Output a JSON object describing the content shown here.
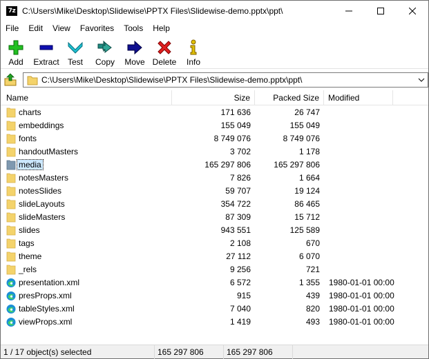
{
  "window": {
    "app_icon_text": "7z",
    "title": "C:\\Users\\Mike\\Desktop\\Slidewise\\PPTX Files\\Slidewise-demo.pptx\\ppt\\"
  },
  "menu": [
    "File",
    "Edit",
    "View",
    "Favorites",
    "Tools",
    "Help"
  ],
  "toolbar": [
    {
      "label": "Add",
      "icon": "plus-icon",
      "color": "#22c022"
    },
    {
      "label": "Extract",
      "icon": "minus-icon",
      "color": "#1010b0"
    },
    {
      "label": "Test",
      "icon": "check-chevron-icon",
      "color": "#20c0d0"
    },
    {
      "label": "Copy",
      "icon": "double-arrow-icon",
      "color": "#1e8a80"
    },
    {
      "label": "Move",
      "icon": "right-arrow-icon",
      "color": "#101090"
    },
    {
      "label": "Delete",
      "icon": "x-icon",
      "color": "#e02020"
    },
    {
      "label": "Info",
      "icon": "info-icon",
      "color": "#e0c000"
    }
  ],
  "address": {
    "path": "C:\\Users\\Mike\\Desktop\\Slidewise\\PPTX Files\\Slidewise-demo.pptx\\ppt\\"
  },
  "columns": {
    "name": "Name",
    "size": "Size",
    "packed": "Packed Size",
    "modified": "Modified"
  },
  "rows": [
    {
      "name": "charts",
      "type": "folder",
      "size": "171 636",
      "packed": "26 747",
      "modified": ""
    },
    {
      "name": "embeddings",
      "type": "folder",
      "size": "155 049",
      "packed": "155 049",
      "modified": ""
    },
    {
      "name": "fonts",
      "type": "folder",
      "size": "8 749 076",
      "packed": "8 749 076",
      "modified": ""
    },
    {
      "name": "handoutMasters",
      "type": "folder",
      "size": "3 702",
      "packed": "1 178",
      "modified": ""
    },
    {
      "name": "media",
      "type": "folder",
      "size": "165 297 806",
      "packed": "165 297 806",
      "modified": "",
      "selected": true
    },
    {
      "name": "notesMasters",
      "type": "folder",
      "size": "7 826",
      "packed": "1 664",
      "modified": ""
    },
    {
      "name": "notesSlides",
      "type": "folder",
      "size": "59 707",
      "packed": "19 124",
      "modified": ""
    },
    {
      "name": "slideLayouts",
      "type": "folder",
      "size": "354 722",
      "packed": "86 465",
      "modified": ""
    },
    {
      "name": "slideMasters",
      "type": "folder",
      "size": "87 309",
      "packed": "15 712",
      "modified": ""
    },
    {
      "name": "slides",
      "type": "folder",
      "size": "943 551",
      "packed": "125 589",
      "modified": ""
    },
    {
      "name": "tags",
      "type": "folder",
      "size": "2 108",
      "packed": "670",
      "modified": ""
    },
    {
      "name": "theme",
      "type": "folder",
      "size": "27 112",
      "packed": "6 070",
      "modified": ""
    },
    {
      "name": "_rels",
      "type": "folder",
      "size": "9 256",
      "packed": "721",
      "modified": ""
    },
    {
      "name": "presentation.xml",
      "type": "xml",
      "size": "6 572",
      "packed": "1 355",
      "modified": "1980-01-01 00:00"
    },
    {
      "name": "presProps.xml",
      "type": "xml",
      "size": "915",
      "packed": "439",
      "modified": "1980-01-01 00:00"
    },
    {
      "name": "tableStyles.xml",
      "type": "xml",
      "size": "7 040",
      "packed": "820",
      "modified": "1980-01-01 00:00"
    },
    {
      "name": "viewProps.xml",
      "type": "xml",
      "size": "1 419",
      "packed": "493",
      "modified": "1980-01-01 00:00"
    }
  ],
  "status": {
    "selection": "1 / 17 object(s) selected",
    "size": "165 297 806",
    "packed": "165 297 806"
  },
  "colors": {
    "folder": "#f4d36b",
    "selection": "#cce8ff",
    "edge_icon": "#1a8fd6"
  }
}
